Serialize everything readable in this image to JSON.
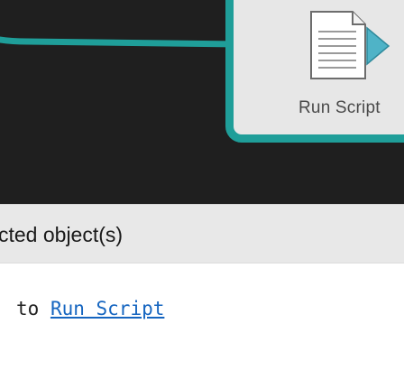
{
  "canvas": {
    "node": {
      "label": "Run Script",
      "icon": "run-script-document-icon",
      "border_color": "#1f9e99",
      "background": "#e7e7e7"
    },
    "connector_color": "#1f9e99",
    "background": "#1f1f1f"
  },
  "properties": {
    "header_title": "cted object(s)",
    "connection_prefix": "to ",
    "connection_target": "Run Script",
    "link_color": "#1565c0"
  }
}
